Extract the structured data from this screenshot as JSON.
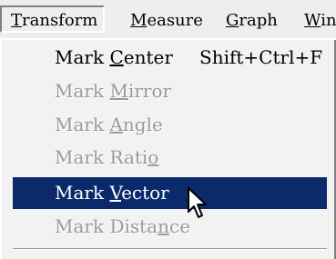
{
  "menubar": {
    "transform": {
      "prefix": "",
      "accel": "T",
      "rest": "ransform"
    },
    "measure": {
      "prefix": "",
      "accel": "M",
      "rest": "easure"
    },
    "graph": {
      "prefix": "",
      "accel": "G",
      "rest": "raph"
    },
    "window": {
      "prefix": "",
      "accel": "W",
      "rest": "in"
    }
  },
  "menu": {
    "items": [
      {
        "prefix": "Mark ",
        "accel": "C",
        "rest": "enter",
        "shortcut": "Shift+Ctrl+F",
        "state": "enabled"
      },
      {
        "prefix": "Mark ",
        "accel": "M",
        "rest": "irror",
        "state": "disabled"
      },
      {
        "prefix": "Mark ",
        "accel": "A",
        "rest": "ngle",
        "state": "disabled"
      },
      {
        "prefix": "Mark Rati",
        "accel": "o",
        "rest": "",
        "state": "disabled"
      },
      {
        "prefix": "Mark ",
        "accel": "V",
        "rest": "ector",
        "state": "highlighted"
      },
      {
        "prefix": "Mark Dista",
        "accel": "n",
        "rest": "ce",
        "state": "disabled"
      }
    ]
  },
  "colors": {
    "highlight": "#0a2a6b",
    "disabled_text": "#9a9a9a",
    "background": "#f2f2f2"
  },
  "cursor": {
    "icon": "arrow-pointer-icon"
  }
}
